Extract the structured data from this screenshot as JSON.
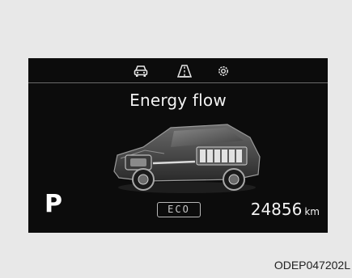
{
  "cluster": {
    "tabs": [
      {
        "icon": "car-icon"
      },
      {
        "icon": "road-icon"
      },
      {
        "icon": "settings-icon"
      }
    ],
    "screen_title": "Energy flow",
    "gear": "P",
    "drive_mode": "ECO",
    "odometer_value": "24856",
    "odometer_unit": "km"
  },
  "figure_code": "ODEP047202L",
  "colors": {
    "panel_bg": "#0c0c0c",
    "page_bg": "#e8e8e8",
    "text": "#f2f2f2"
  }
}
